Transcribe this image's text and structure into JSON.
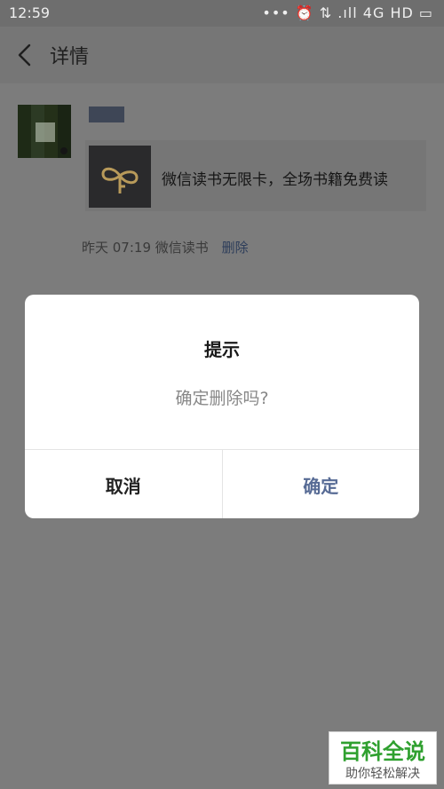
{
  "status_bar": {
    "time": "12:59",
    "indicators": "••• ⏰ ⇅ .ıll 4G HD ▭"
  },
  "header": {
    "title": "详情"
  },
  "post": {
    "share_title": "微信读书无限卡，全场书籍免费读",
    "meta_time": "昨天 07:19",
    "meta_source": "微信读书",
    "delete_label": "删除"
  },
  "dialog": {
    "title": "提示",
    "message": "确定删除吗?",
    "cancel_label": "取消",
    "confirm_label": "确定"
  },
  "watermark": {
    "main": "百科全说",
    "sub": "助你轻松解决"
  },
  "colors": {
    "overlay": "#7f7f7f",
    "accent_link": "#576b95",
    "watermark_green": "#2fa02f"
  }
}
